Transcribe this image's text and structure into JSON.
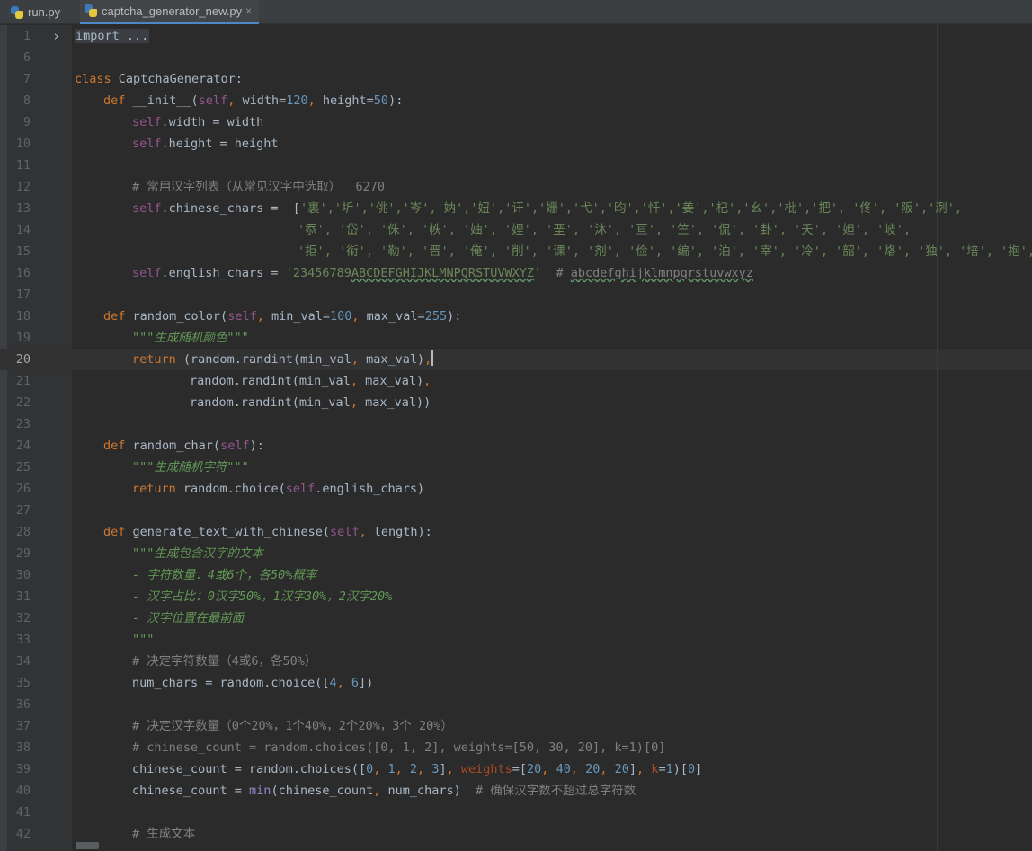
{
  "tabs": [
    {
      "label": "run.py",
      "active": false
    },
    {
      "label": "captcha_generator_new.py",
      "active": true,
      "close": "×"
    }
  ],
  "editor": {
    "current_line": 20,
    "line_numbers": [
      "1",
      "6",
      "7",
      "8",
      "9",
      "10",
      "11",
      "12",
      "13",
      "14",
      "15",
      "16",
      "17",
      "18",
      "19",
      "20",
      "21",
      "22",
      "23",
      "24",
      "25",
      "26",
      "27",
      "28",
      "29",
      "30",
      "31",
      "32",
      "33",
      "34",
      "35",
      "36",
      "37",
      "38",
      "39",
      "40",
      "41",
      "42"
    ],
    "fold_marker": "›",
    "code": {
      "import_fold": "import ...",
      "l7_kw": "class",
      "l7_name": " CaptchaGenerator:",
      "l8_def": "def",
      "l8_name": " __init__(",
      "l8_self": "self",
      "l8_c1": ",",
      "l8_w": " width=",
      "l8_120": "120",
      "l8_c2": ",",
      "l8_h": " height=",
      "l8_50": "50",
      "l8_end": "):",
      "l9_self": "self",
      "l9_rest": ".width = width",
      "l10_self": "self",
      "l10_rest": ".height = height",
      "l12": "# 常用汉字列表（从常见汉字中选取）  6270",
      "l13_self": "self",
      "l13_rest": ".chinese_chars =  [",
      "l13_str": "'裏','圻','佻','岑','妠','妞','讦','姗','弋','昀','忏','姜','杞','幺','枇','把', '佟', '阪','洌',",
      "l14_str": "'忝', '岱', '侏', '帙', '妯', '娌', '垩', '沐', '亘', '竺', '侃', '卦', '夭', '妲', '岐',",
      "l15_str": "'拒', '衔', '勒', '晋', '俺', '削', '课', '剂', '俭', '编', '泊', '宰', '冷', '韶', '烙', '独', '培', '抱',",
      "l16_self": "self",
      "l16_rest": ".english_chars = ",
      "l16_str_a": "'23456789",
      "l16_str_b": "ABCDEFGHIJKLMNPQRSTUVWXYZ",
      "l16_str_c": "'",
      "l16_cmt_a": "  # ",
      "l16_cmt_b": "abcdefghijklmnpqrstuvwxyz",
      "l18_def": "def",
      "l18_name": " random_color(",
      "l18_self": "self",
      "l18_c1": ",",
      "l18_a": " min_val=",
      "l18_100": "100",
      "l18_c2": ",",
      "l18_b": " max_val=",
      "l18_255": "255",
      "l18_end": "):",
      "l19": "\"\"\"生成随机颜色\"\"\"",
      "l20_kw": "return",
      "l20_rest": " (random.randint(min_val",
      "l20_c": ",",
      "l20_rest2": " max_val)",
      "l20_c2": ",",
      "l21_a": "random.randint(min_val",
      "l21_c": ",",
      "l21_b": " max_val)",
      "l21_c2": ",",
      "l22_a": "random.randint(min_val",
      "l22_c": ",",
      "l22_b": " max_val))",
      "l24_def": "def",
      "l24_name": " random_char(",
      "l24_self": "self",
      "l24_end": "):",
      "l25": "\"\"\"生成随机字符\"\"\"",
      "l26_kw": "return",
      "l26_a": " random.choice(",
      "l26_self": "self",
      "l26_b": ".english_chars)",
      "l28_def": "def",
      "l28_name": " generate_text_with_chinese(",
      "l28_self": "self",
      "l28_c": ",",
      "l28_end": " length):",
      "l29": "\"\"\"生成包含汉字的文本",
      "l30": "- 字符数量：4或6个，各50%概率",
      "l31": "- 汉字占比：0汉字50%，1汉字30%，2汉字20%",
      "l32": "- 汉字位置在最前面",
      "l33": "\"\"\"",
      "l34": "# 决定字符数量（4或6，各50%）",
      "l35_a": "num_chars = random.choice([",
      "l35_4": "4",
      "l35_c": ",",
      "l35_6": " 6",
      "l35_end": "])",
      "l37": "# 决定汉字数量（0个20%，1个40%，2个20%，3个 20%）",
      "l38": "# chinese_count = random.choices([0, 1, 2], weights=[50, 30, 20], k=1)[0]",
      "l39_a": "chinese_count = random.choices([",
      "l39_0": "0",
      "l39_c1": ",",
      "l39_1": " 1",
      "l39_c2": ",",
      "l39_2": " 2",
      "l39_c3": ",",
      "l39_3": " 3",
      "l39_b": "]",
      "l39_c4": ",",
      "l39_w": " weights",
      "l39_eq": "=[",
      "l39_20a": "20",
      "l39_c5": ",",
      "l39_40": " 40",
      "l39_c6": ",",
      "l39_20b": " 20",
      "l39_c7": ",",
      "l39_20c": " 20",
      "l39_d": "]",
      "l39_c8": ",",
      "l39_k": " k",
      "l39_e": "=",
      "l39_k1": "1",
      "l39_f": ")[",
      "l39_z": "0",
      "l39_g": "]",
      "l40_a": "chinese_count = ",
      "l40_min": "min",
      "l40_b": "(chinese_count",
      "l40_c": ",",
      "l40_d": " num_chars)",
      "l40_cmt": "  # 确保汉字数不超过总字符数",
      "l42": "# 生成文本"
    }
  },
  "colors": {
    "background": "#2b2b2b",
    "gutter": "#313335",
    "keyword": "#cc7832",
    "string": "#6a8759",
    "number": "#6897bb",
    "self": "#94558d",
    "comment": "#808080",
    "docstring": "#629755",
    "tab_underline": "#4a88c7"
  }
}
